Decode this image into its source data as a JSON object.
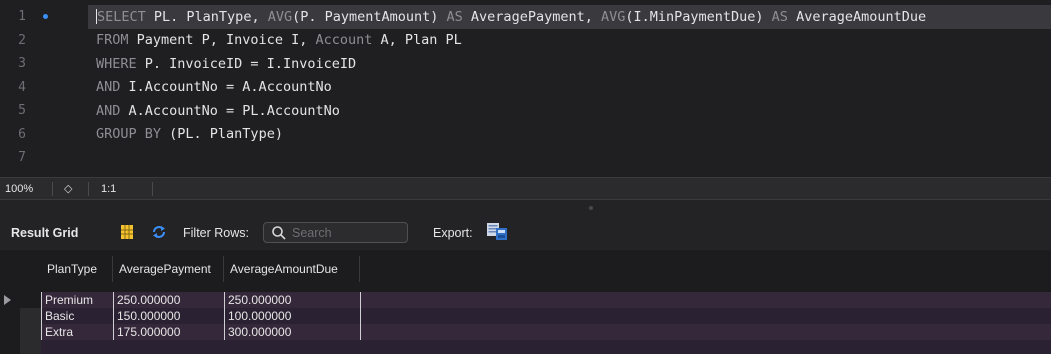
{
  "editor": {
    "lines": [
      {
        "num": "1",
        "segments": [
          [
            "kw",
            "SELECT"
          ],
          [
            "t",
            " PL. PlanType, "
          ],
          [
            "kw",
            "AVG"
          ],
          [
            "t",
            "(P. PaymentAmount) "
          ],
          [
            "kw",
            "AS"
          ],
          [
            "t",
            " AveragePayment, "
          ],
          [
            "kw",
            "AVG"
          ],
          [
            "t",
            "(I.MinPaymentDue) "
          ],
          [
            "kw",
            "AS"
          ],
          [
            "t",
            " AverageAmountDue"
          ]
        ]
      },
      {
        "num": "2",
        "segments": [
          [
            "kw",
            "FROM"
          ],
          [
            "t",
            " Payment P, Invoice I, "
          ],
          [
            "kw",
            "Account"
          ],
          [
            "t",
            " A, Plan PL"
          ]
        ]
      },
      {
        "num": "3",
        "segments": [
          [
            "kw",
            "WHERE"
          ],
          [
            "t",
            " P. InvoiceID = I.InvoiceID"
          ]
        ]
      },
      {
        "num": "4",
        "segments": [
          [
            "kw",
            "AND"
          ],
          [
            "t",
            " I.AccountNo = A.AccountNo"
          ]
        ]
      },
      {
        "num": "5",
        "segments": [
          [
            "kw",
            "AND"
          ],
          [
            "t",
            " A.AccountNo = PL.AccountNo"
          ]
        ]
      },
      {
        "num": "6",
        "segments": [
          [
            "kw",
            "GROUP BY"
          ],
          [
            "t",
            " (PL. PlanType)"
          ]
        ]
      },
      {
        "num": "7",
        "segments": []
      }
    ]
  },
  "status": {
    "zoom": "100%",
    "stepper": "◇",
    "cursor_position": "1:1"
  },
  "toolbar": {
    "title": "Result Grid",
    "filter_label": "Filter Rows:",
    "search_placeholder": "Search",
    "export_label": "Export:"
  },
  "grid": {
    "columns": [
      "PlanType",
      "AveragePayment",
      "AverageAmountDue"
    ],
    "rows": [
      [
        "Premium",
        "250.000000",
        "250.000000"
      ],
      [
        "Basic",
        "150.000000",
        "100.000000"
      ],
      [
        "Extra",
        "175.000000",
        "300.000000"
      ]
    ]
  },
  "colors": {
    "keyword": "#8e8e93",
    "breakpoint_dot": "#3b8ff6",
    "row_odd": "#35283a",
    "row_even": "#2a2232"
  }
}
